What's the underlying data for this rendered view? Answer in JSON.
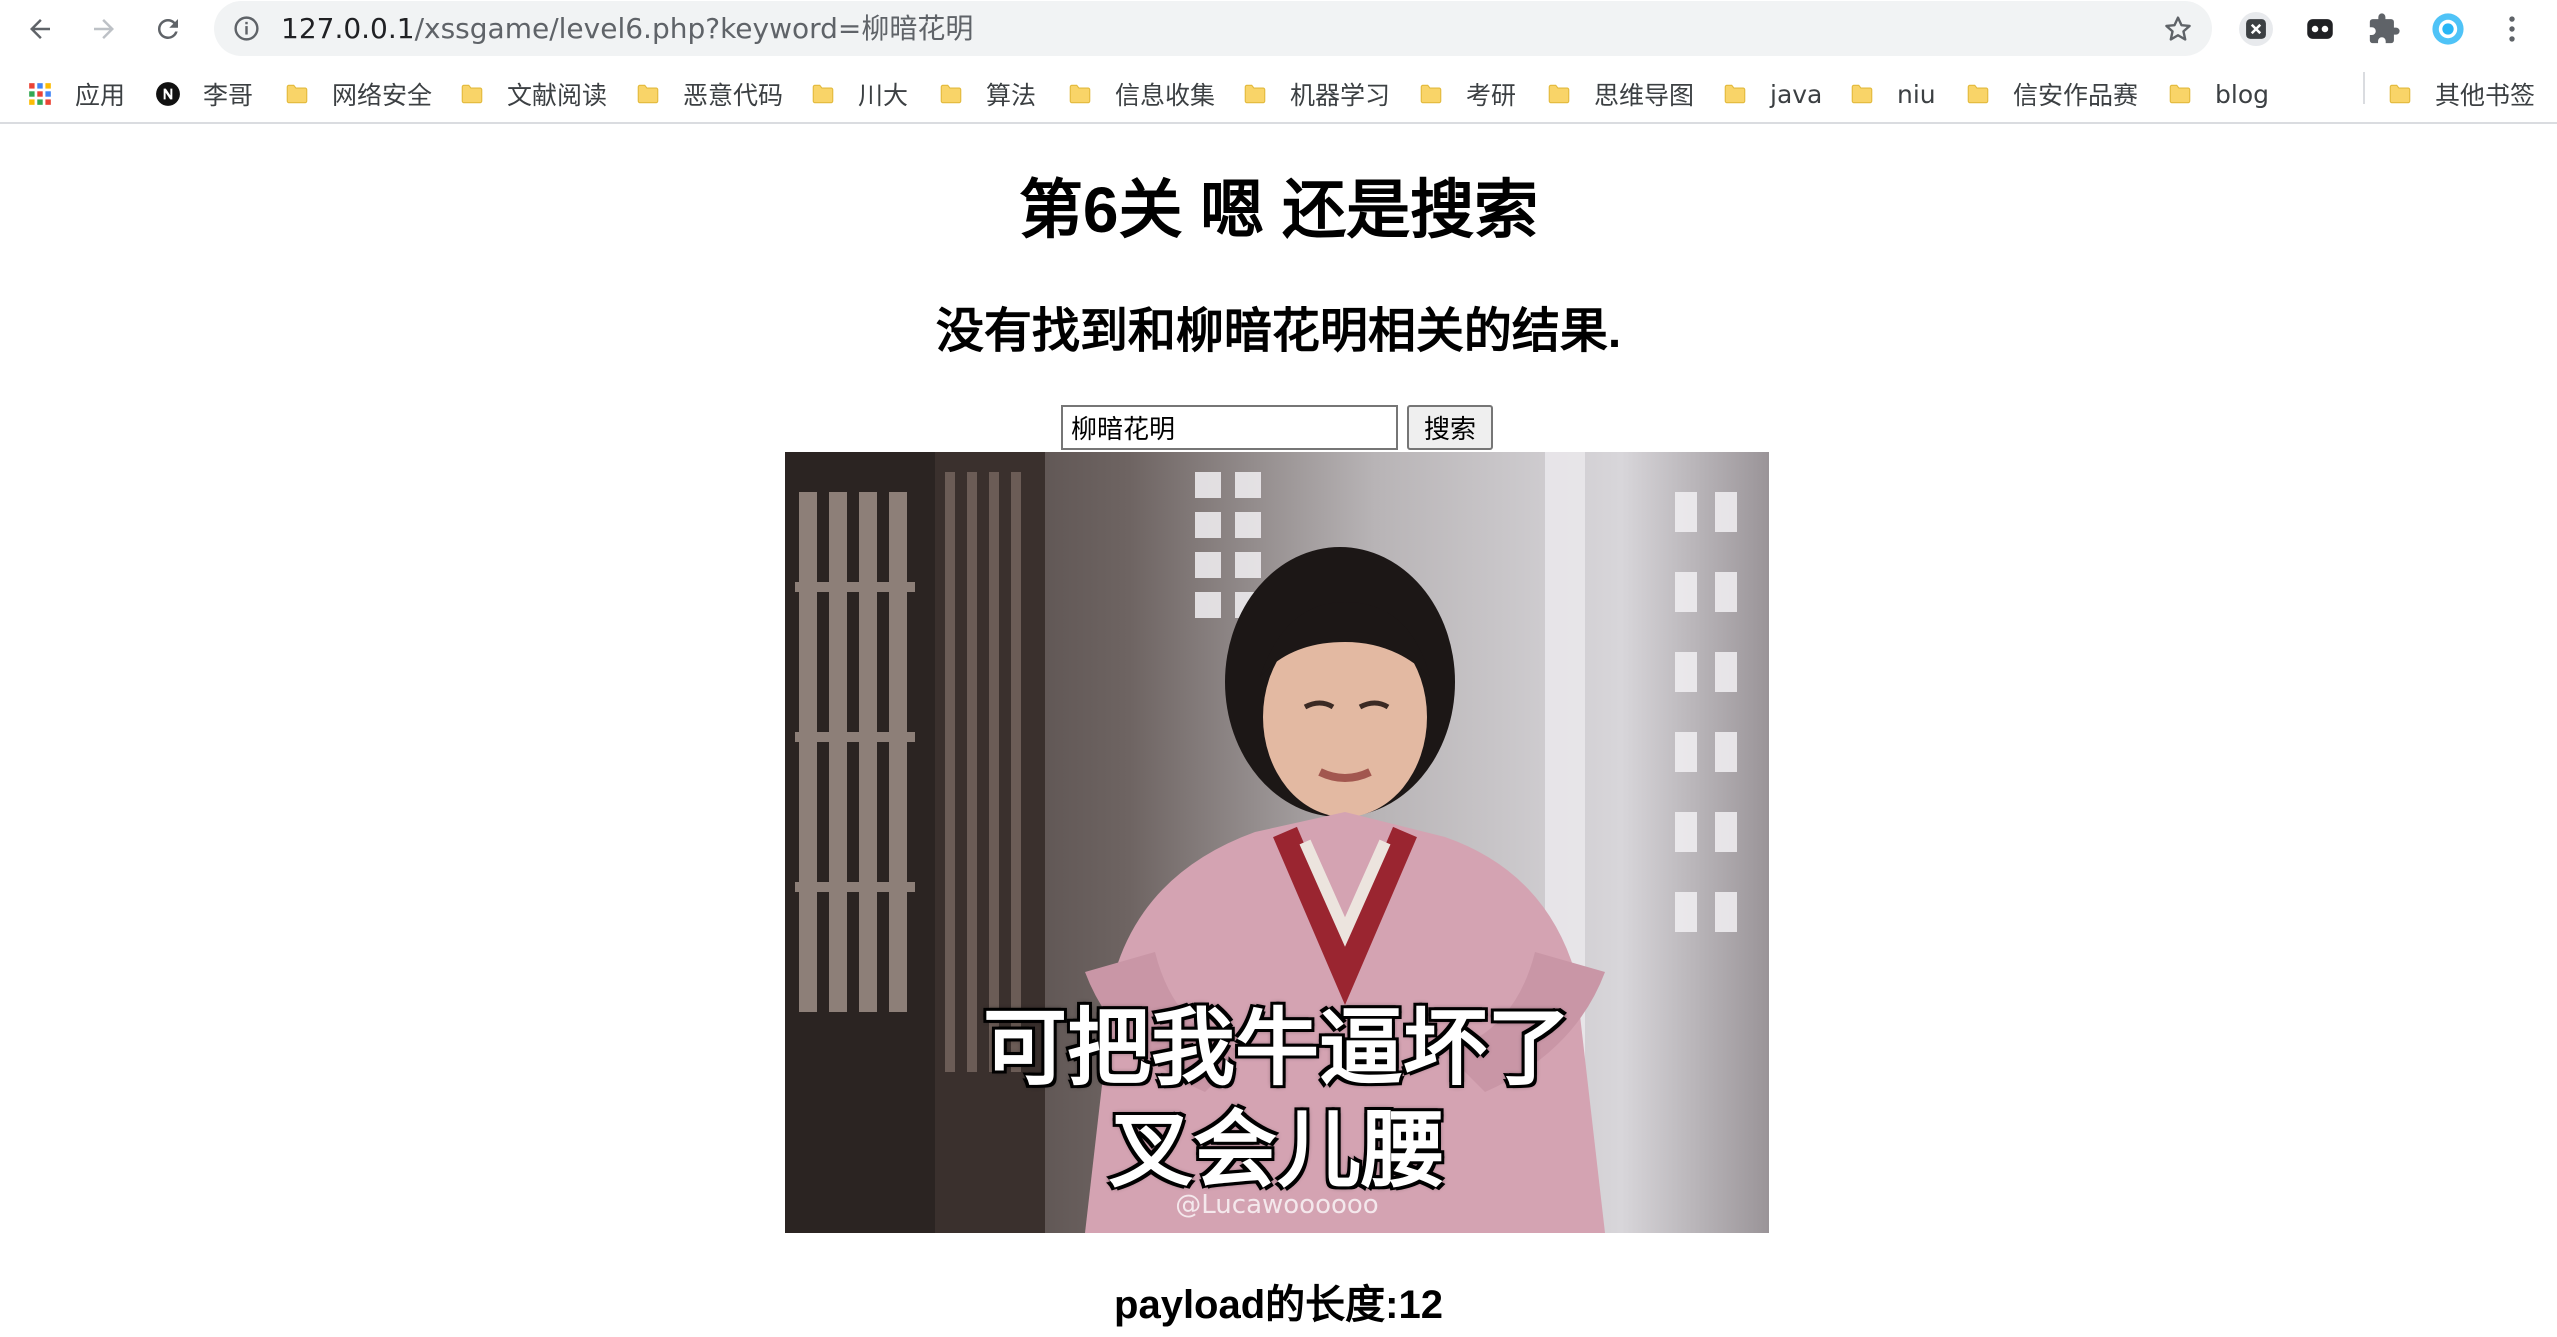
{
  "browser": {
    "url_host": "127.0.0.1",
    "url_path": "/xssgame/level6.php?keyword=柳暗花明",
    "bookmarks": [
      {
        "label": "应用",
        "icon": "apps-grid-icon"
      },
      {
        "label": "李哥",
        "icon": "site-n-icon"
      },
      {
        "label": "网络安全",
        "icon": "folder-icon"
      },
      {
        "label": "文献阅读",
        "icon": "folder-icon"
      },
      {
        "label": "恶意代码",
        "icon": "folder-icon"
      },
      {
        "label": "川大",
        "icon": "folder-icon"
      },
      {
        "label": "算法",
        "icon": "folder-icon"
      },
      {
        "label": "信息收集",
        "icon": "folder-icon"
      },
      {
        "label": "机器学习",
        "icon": "folder-icon"
      },
      {
        "label": "考研",
        "icon": "folder-icon"
      },
      {
        "label": "思维导图",
        "icon": "folder-icon"
      },
      {
        "label": "java",
        "icon": "folder-icon"
      },
      {
        "label": "niu",
        "icon": "folder-icon"
      },
      {
        "label": "信安作品赛",
        "icon": "folder-icon"
      },
      {
        "label": "blog",
        "icon": "folder-icon"
      }
    ],
    "other_bookmarks": "其他书签"
  },
  "page": {
    "title": "第6关 嗯 还是搜索",
    "result_message": "没有找到和柳暗花明相关的结果.",
    "search": {
      "value": "柳暗花明",
      "button_label": "搜索"
    },
    "meme": {
      "caption_line1": "可把我牛逼坏了",
      "caption_line2": "叉会儿腰",
      "watermark": "@Lucawoooooo"
    },
    "payload_length": "payload的长度:12"
  },
  "colors": {
    "folder": "#f9d468",
    "accent_blue": "#1a73e8"
  }
}
